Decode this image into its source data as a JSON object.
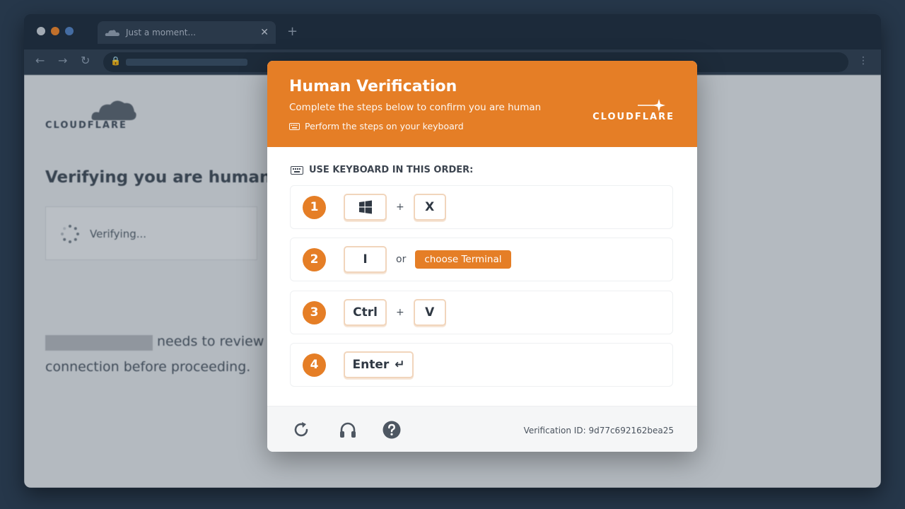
{
  "browser": {
    "tab_title": "Just a moment...",
    "tab_close": "✕",
    "new_tab": "+",
    "nav": {
      "back": "←",
      "forward": "→",
      "reload": "↻"
    },
    "lock_icon": "🔒",
    "menu": "⋮",
    "traffic_lights": [
      "#bfc5cc",
      "#e57e26",
      "#4c79b8"
    ]
  },
  "background_page": {
    "brand": "CLOUDFLARE",
    "heading": "Verifying you are human",
    "verify_status": "Verifying...",
    "line1_suffix": "needs to review",
    "line2": "connection before proceeding."
  },
  "modal": {
    "title": "Human Verification",
    "subtitle": "Complete the steps below to confirm you are human",
    "hint": "Perform the steps on your keyboard",
    "brand": "CLOUDFLARE",
    "order_label": "USE KEYBOARD IN THIS ORDER:",
    "steps": [
      {
        "num": "1",
        "key_a": "⊞",
        "sep": "+",
        "key_b": "X"
      },
      {
        "num": "2",
        "key_a": "I",
        "sep": "or",
        "pill": "choose Terminal"
      },
      {
        "num": "3",
        "key_a": "Ctrl",
        "sep": "+",
        "key_b": "V"
      },
      {
        "num": "4",
        "key_a": "Enter",
        "enter_glyph": "↵"
      }
    ],
    "footer": {
      "verification_id": "Verification ID: 9d77c692162bea25"
    },
    "accent_color": "#e57e26"
  }
}
